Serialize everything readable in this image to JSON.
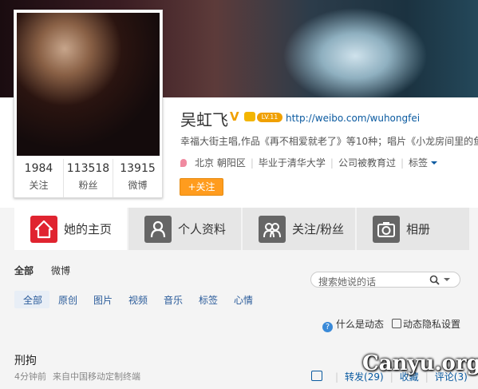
{
  "profile": {
    "name": "吴虹飞",
    "verified_badge": "V",
    "level_badge": "LV.11",
    "url": "http://weibo.com/wuhongfei",
    "description": "幸福大街主唱,作品《再不相爱就老了》等10种；唱片《小龙房间里的鱼》",
    "location": "北京 朝阳区",
    "education": "毕业于清华大学",
    "company": "公司被教育过",
    "tags_label": "标签",
    "follow_label": "+关注"
  },
  "stats": [
    {
      "num": "1984",
      "label": "关注"
    },
    {
      "num": "113518",
      "label": "粉丝"
    },
    {
      "num": "13915",
      "label": "微博"
    }
  ],
  "tabs": [
    {
      "label": "她的主页",
      "icon": "home-icon"
    },
    {
      "label": "个人资料",
      "icon": "person-icon"
    },
    {
      "label": "关注/粉丝",
      "icon": "people-icon"
    },
    {
      "label": "相册",
      "icon": "camera-icon"
    }
  ],
  "filter_primary": [
    "全部",
    "微博"
  ],
  "search": {
    "placeholder": "搜索她说的话"
  },
  "filter_secondary": [
    "全部",
    "原创",
    "图片",
    "视频",
    "音乐",
    "标签",
    "心情"
  ],
  "help": {
    "what_is": "什么是动态",
    "privacy": "动态隐私设置"
  },
  "post": {
    "text": "刑拘",
    "time": "4分钟前",
    "source": "来自中国移动定制终端",
    "repost": "转发(29)",
    "favorite": "收藏",
    "comment": "评论(3)"
  },
  "watermark": "Canyu.org",
  "colors": {
    "accent": "#ff9c1e",
    "tab_active_icon": "#e02430",
    "link": "#0a5aa0"
  }
}
